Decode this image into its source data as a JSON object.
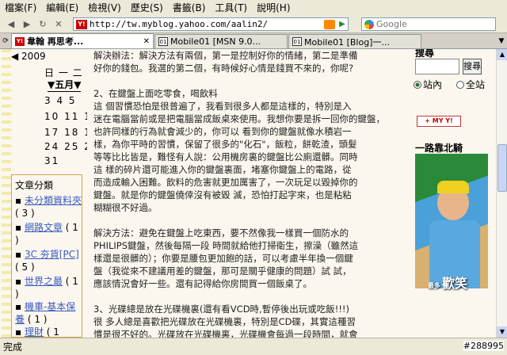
{
  "menu": [
    "檔案(F)",
    "編輯(E)",
    "檢視(V)",
    "歷史(S)",
    "書籤(B)",
    "工具(T)",
    "說明(H)"
  ],
  "url": "http://tw.myblog.yahoo.com/aalin2/",
  "search_placeholder": "Google",
  "tabs": [
    {
      "label": "韋翰 再思考...",
      "icon": "Y!",
      "active": true
    },
    {
      "label": "Mobile01 [MSN 9.0...",
      "icon": "01",
      "active": false
    },
    {
      "label": "Mobile01 [Blog]一...",
      "icon": "01",
      "active": false
    }
  ],
  "calendar": {
    "year_nav": "◀ 2009",
    "month": "▼五月▼",
    "dow": "日 一 二",
    "rows": [
      " 3  4  5",
      "10 11 12",
      "17 18 19",
      "24 25 26",
      "31"
    ]
  },
  "categories": {
    "title": "文章分類",
    "items": [
      {
        "name": "未分類資料夾",
        "count": "( 3 )"
      },
      {
        "name": "網路文章",
        "count": "( 1 )"
      },
      {
        "name": "3C 夯貨[PC]",
        "count": "( 5 )"
      },
      {
        "name": "世界之最",
        "count": "( 1 )"
      },
      {
        "name": "機車-基本保養",
        "count": "( 1 )"
      },
      {
        "name": "理財",
        "count": "( 1"
      }
    ]
  },
  "article": {
    "lines": [
      "解決辦法：解決方法有兩個，第一是控制好你的情緒，第二是準備",
      "好你的錢包。我選的第二個，有時候好心情是錢買不來的，你呢?",
      "",
      "2、在鍵盤上面吃零食，喝飲料",
      "這 個習慣恐怕是很普遍了，我看到很多人都是這樣的，特別是入",
      "迷在電腦當前或是把電腦當成飯桌來使用。我想你要是拆一回你的鍵盤，",
      "也許同樣的行為就會減少的，你可以 看到你的鍵盤就像水積岩一",
      "樣，為你平時的習慣，保留了很多的\"化石\"，飯粒，餅乾渣，頭髮",
      "等等比比皆是，難怪有人說：公用機房裏的鍵盤比公廁還髒。同時",
      "這 樣的碎片還可能進入你的鍵盤裏面，堵塞你鍵盤上的電路，從",
      "而造成輸入困難。飲料的危害就更加厲害了，一次玩足以毀掉你的",
      "鍵盤。就是你的鍵盤僥倖沒有被毀 滅，恐怕打起字來，也是粘粘",
      "糊糊很不好過。",
      "",
      "解決方法：避免在鍵盤上吃東西，要不然像我一樣買一個防水的",
      "PHILIPS鍵盤，然後每隔一段 時間就給他打掃衛生，擦澡（雖然這",
      "樣還是很髒的）；你要是腰包更加飽的話，可以考慮半年換一個鍵",
      "盤（我從來不建議用差的鍵盤，那可是關乎健康的問題）試 試，",
      "應該情況會好一些。還有記得給你房間買一個飯桌了。",
      "",
      "3、光碟總是放在光碟機裏(還有看VCD時,暫停後出玩或吃飯!!!)",
      "很 多人總是喜歡把光碟放在光碟機裏，特別是CD碟，其實這種習",
      "慣是很不好的。光碟放在光碟機裏，光碟機會每過一段時間，就會"
    ]
  },
  "right": {
    "search_title": "搜尋",
    "search_btn": "搜尋",
    "radio1": "站內",
    "radio2": "全站",
    "myyahoo": "+ MY Y!",
    "widget_title": "一路靠北騎",
    "photo_caption_small": "最多",
    "photo_caption_big": "歡笑"
  },
  "status": "完成",
  "watermark": "#288995"
}
